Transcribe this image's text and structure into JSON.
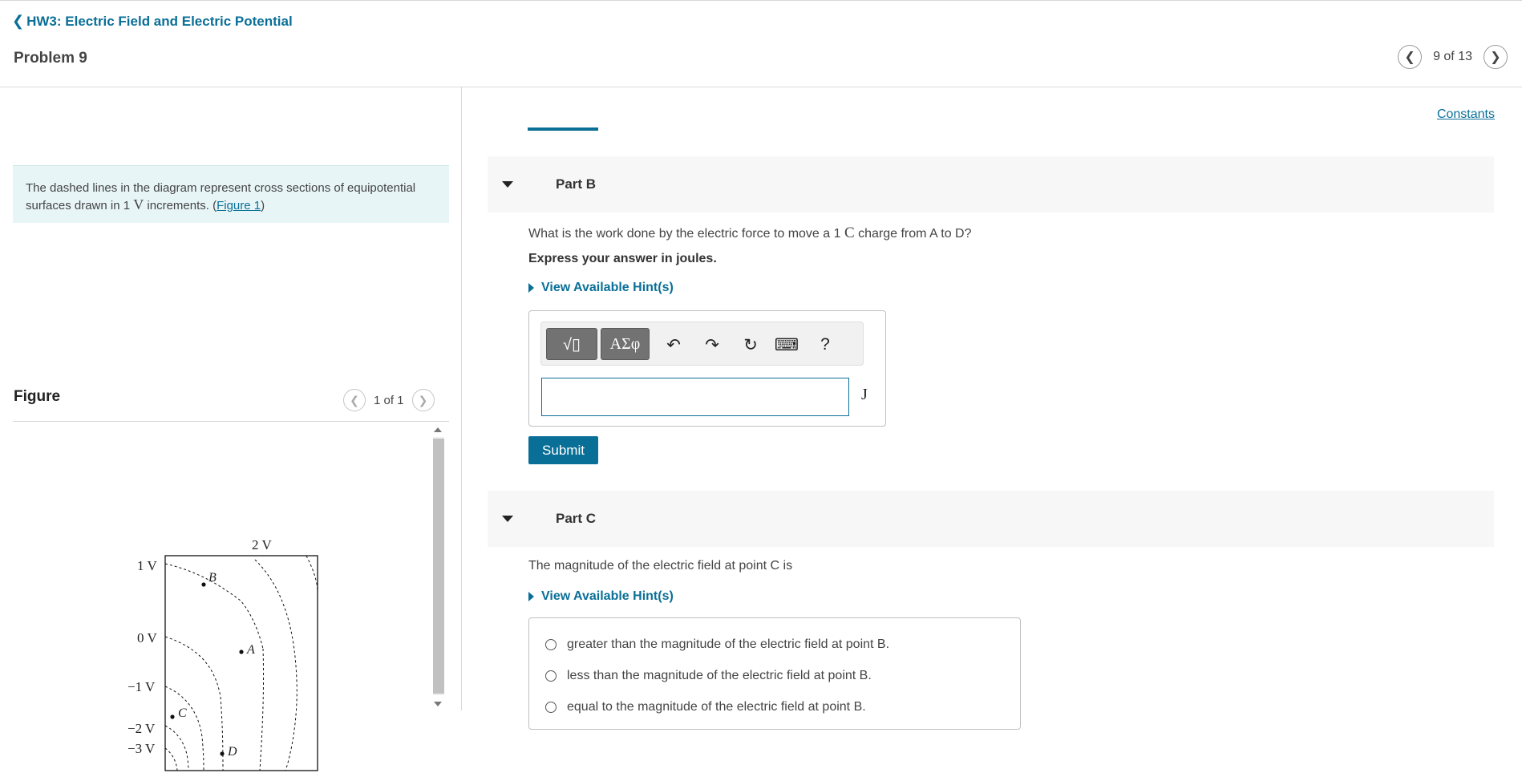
{
  "header": {
    "back_label": "HW3: Electric Field and Electric Potential",
    "problem_title": "Problem 9",
    "pager_text": "9 of 13"
  },
  "left": {
    "intro_before": "The dashed lines in the diagram represent cross sections of equipotential surfaces drawn in 1 ",
    "intro_unit": "V",
    "intro_after": " increments. (",
    "intro_link": "Figure 1",
    "intro_close": ")",
    "figure_title": "Figure",
    "figure_pager": "1 of 1",
    "figure": {
      "top_label": "2 V",
      "left_labels": [
        "1 V",
        "0 V",
        "−1 V",
        "−2 V",
        "−3 V"
      ],
      "points": [
        "B",
        "A",
        "C",
        "D"
      ]
    }
  },
  "right": {
    "constants": "Constants",
    "part_b": {
      "label": "Part B",
      "question_before": "What is the work done by the electric force to move a 1 ",
      "question_unit": "C",
      "question_after": " charge from A to D?",
      "instruction": "Express your answer in joules.",
      "hint": "View Available Hint(s)",
      "toolbar": {
        "templates_glyph": "√▯",
        "symbols_label": "ΑΣφ",
        "undo_glyph": "↶",
        "redo_glyph": "↷",
        "reset_glyph": "↻",
        "keyboard_glyph": "⌨",
        "help_label": "?"
      },
      "answer_value": "",
      "unit": "J",
      "submit": "Submit"
    },
    "part_c": {
      "label": "Part C",
      "question": "The magnitude of the electric field at point C is",
      "hint": "View Available Hint(s)",
      "choices": [
        "greater than the magnitude of the electric field at point B.",
        "less than the magnitude of the electric field at point B.",
        "equal to the magnitude of the electric field at point B."
      ]
    }
  }
}
